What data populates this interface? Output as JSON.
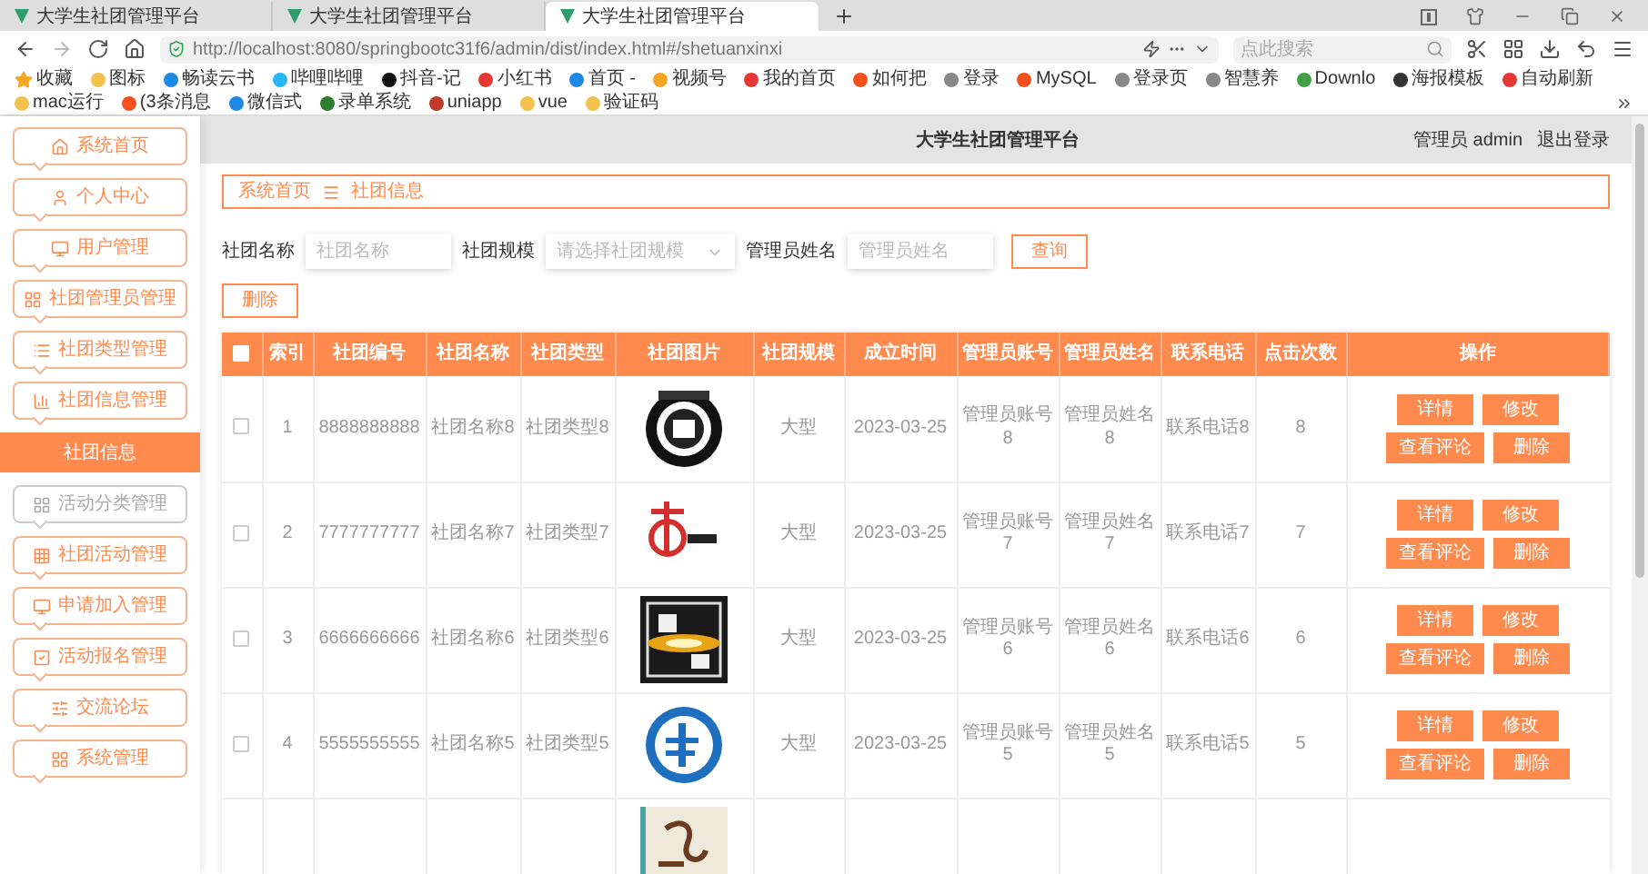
{
  "browser": {
    "tabs": [
      {
        "title": "大学生社团管理平台",
        "selected": false
      },
      {
        "title": "大学生社团管理平台",
        "selected": false
      },
      {
        "title": "大学生社团管理平台",
        "selected": true
      }
    ],
    "url": "http://localhost:8080/springbootc31f6/admin/dist/index.html#/shetuanxinxi",
    "search_placeholder": "点此搜索",
    "bookmarks": [
      {
        "label": "收藏",
        "color": "#f5a623"
      },
      {
        "label": "图标",
        "color": "#f2c14e"
      },
      {
        "label": "畅读云书",
        "color": "#1e88e5"
      },
      {
        "label": "哔哩哔哩",
        "color": "#29b6f6"
      },
      {
        "label": "抖音-记",
        "color": "#111111"
      },
      {
        "label": "小红书",
        "color": "#e53935"
      },
      {
        "label": "首页 -",
        "color": "#1e88e5"
      },
      {
        "label": "视频号",
        "color": "#f5a623"
      },
      {
        "label": "我的首页",
        "color": "#e53935"
      },
      {
        "label": "如何把",
        "color": "#f4511e"
      },
      {
        "label": "登录",
        "color": "#888888"
      },
      {
        "label": "MySQL",
        "color": "#f4511e"
      },
      {
        "label": "登录页",
        "color": "#888888"
      },
      {
        "label": "智慧养",
        "color": "#888888"
      },
      {
        "label": "Downlo",
        "color": "#43a047"
      },
      {
        "label": "海报模板",
        "color": "#333333"
      },
      {
        "label": "自动刷新",
        "color": "#e53935"
      },
      {
        "label": "mac运行",
        "color": "#f2c14e"
      },
      {
        "label": "(3条消息",
        "color": "#f4511e"
      },
      {
        "label": "微信式",
        "color": "#1e88e5"
      },
      {
        "label": "录单系统",
        "color": "#2e7d32"
      },
      {
        "label": "uniapp",
        "color": "#c0392b"
      },
      {
        "label": "vue",
        "color": "#f2c14e"
      },
      {
        "label": "验证码",
        "color": "#f2c14e"
      }
    ]
  },
  "header": {
    "title": "大学生社团管理平台",
    "user": "管理员 admin",
    "logout": "退出登录"
  },
  "sidebar": {
    "items": [
      {
        "label": "系统首页",
        "selected": false,
        "hovered": false
      },
      {
        "label": "个人中心",
        "selected": false,
        "hovered": false
      },
      {
        "label": "用户管理",
        "selected": false,
        "hovered": false
      },
      {
        "label": "社团管理员管理",
        "selected": false,
        "hovered": false
      },
      {
        "label": "社团类型管理",
        "selected": false,
        "hovered": false
      },
      {
        "label": "社团信息管理",
        "selected": false,
        "hovered": false
      },
      {
        "label": "社团信息",
        "selected": true,
        "hovered": false
      },
      {
        "label": "活动分类管理",
        "selected": false,
        "hovered": true
      },
      {
        "label": "社团活动管理",
        "selected": false,
        "hovered": false
      },
      {
        "label": "申请加入管理",
        "selected": false,
        "hovered": false
      },
      {
        "label": "活动报名管理",
        "selected": false,
        "hovered": false
      },
      {
        "label": "交流论坛",
        "selected": false,
        "hovered": false
      },
      {
        "label": "系统管理",
        "selected": false,
        "hovered": false
      }
    ]
  },
  "breadcrumb": [
    "系统首页",
    "社团信息"
  ],
  "search": {
    "fields": [
      {
        "kind": "input",
        "label": "社团名称",
        "placeholder": "社团名称"
      },
      {
        "kind": "select",
        "label": "社团规模",
        "placeholder": "请选择社团规模"
      },
      {
        "kind": "input",
        "label": "管理员姓名",
        "placeholder": "管理员姓名"
      }
    ],
    "query_button": "查询"
  },
  "delete_button": "删除",
  "table": {
    "header_checked": false,
    "columns": [
      "索引",
      "社团编号",
      "社团名称",
      "社团类型",
      "社团图片",
      "社团规模",
      "成立时间",
      "管理员账号",
      "管理员姓名",
      "联系电话",
      "点击次数",
      "操作"
    ],
    "rows": [
      {
        "checked": false,
        "cells": [
          "1",
          "8888888888",
          "社团名称8",
          "社团类型8",
          null,
          "大型",
          "2023-03-25",
          "管理员账号8",
          "管理员姓名8",
          "联系电话8",
          "8"
        ],
        "actions": [
          "详情",
          "修改",
          "查看评论",
          "删除"
        ]
      },
      {
        "checked": false,
        "cells": [
          "2",
          "7777777777",
          "社团名称7",
          "社团类型7",
          null,
          "大型",
          "2023-03-25",
          "管理员账号7",
          "管理员姓名7",
          "联系电话7",
          "7"
        ],
        "actions": [
          "详情",
          "修改",
          "查看评论",
          "删除"
        ]
      },
      {
        "checked": false,
        "cells": [
          "3",
          "6666666666",
          "社团名称6",
          "社团类型6",
          null,
          "大型",
          "2023-03-25",
          "管理员账号6",
          "管理员姓名6",
          "联系电话6",
          "6"
        ],
        "actions": [
          "详情",
          "修改",
          "查看评论",
          "删除"
        ]
      },
      {
        "checked": false,
        "cells": [
          "4",
          "5555555555",
          "社团名称5",
          "社团类型5",
          null,
          "大型",
          "2023-03-25",
          "管理员账号5",
          "管理员姓名5",
          "联系电话5",
          "5"
        ],
        "actions": [
          "详情",
          "修改",
          "查看评论",
          "删除"
        ]
      }
    ],
    "partial_row": {
      "kind": "picture"
    }
  }
}
